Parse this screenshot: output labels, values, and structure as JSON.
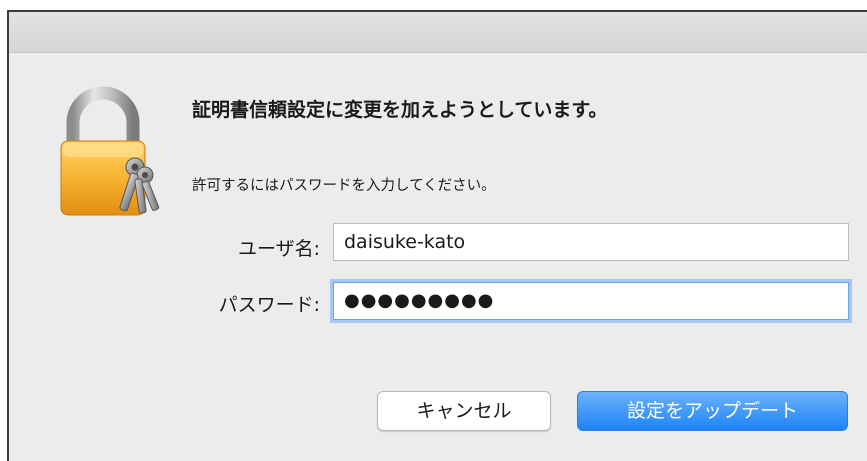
{
  "dialog": {
    "heading": "証明書信頼設定に変更を加えようとしています。",
    "subtext": "許可するにはパスワードを入力してください。",
    "icon": "lock-with-keys-icon",
    "accent_color": "#1e83f7"
  },
  "form": {
    "username_label": "ユーザ名:",
    "username_value": "daisuke-kato",
    "password_label": "パスワード:",
    "password_value": "●●●●●●●●●"
  },
  "buttons": {
    "cancel_label": "キャンセル",
    "update_label": "設定をアップデート"
  }
}
